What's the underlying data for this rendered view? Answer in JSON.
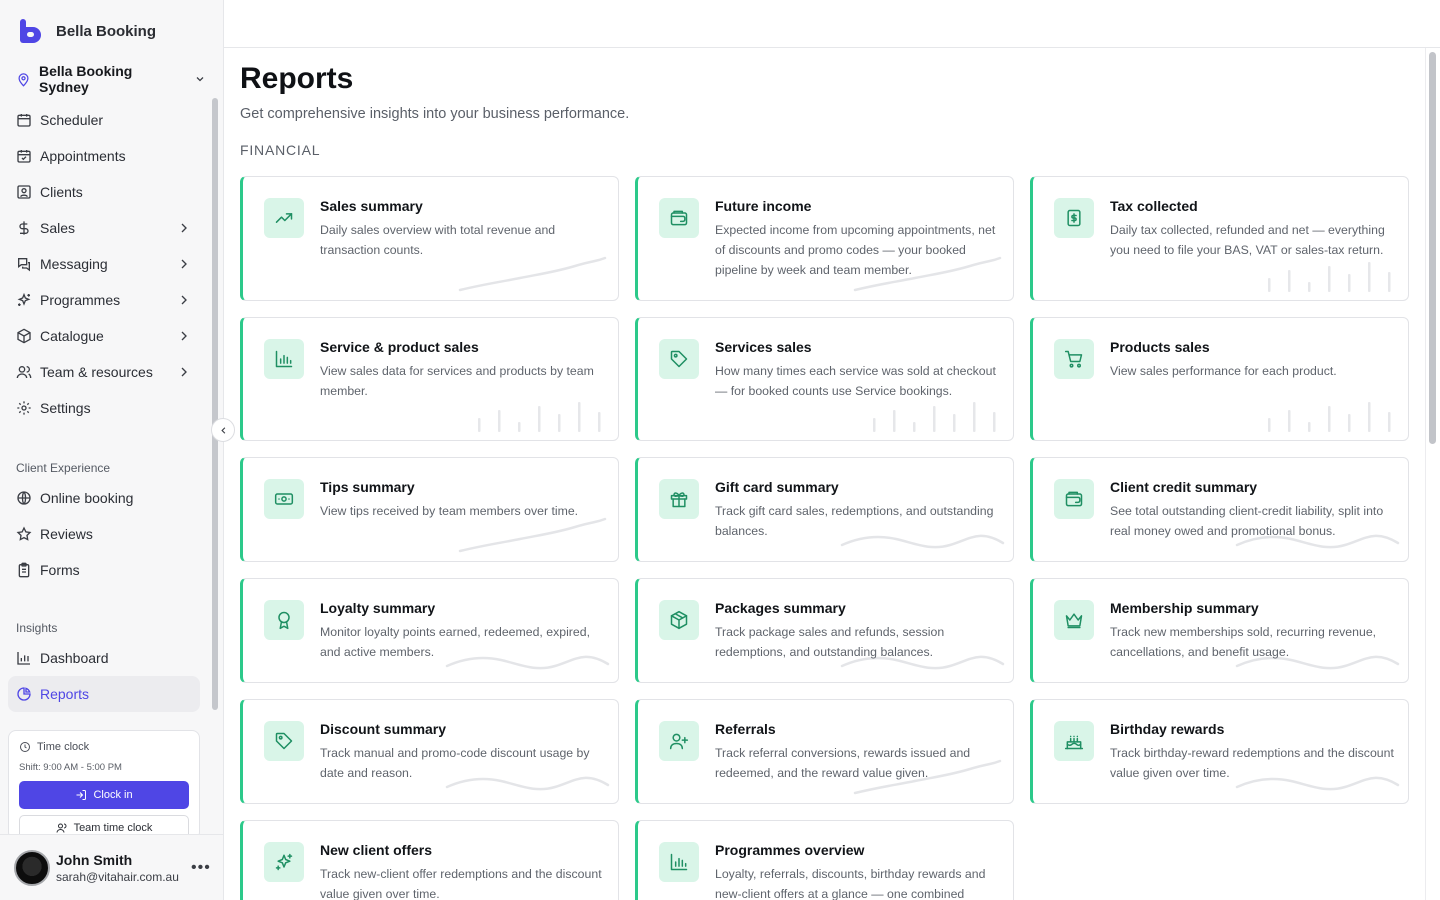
{
  "brand": {
    "name": "Bella Booking"
  },
  "location": {
    "name": "Bella Booking Sydney"
  },
  "nav": {
    "main": [
      {
        "label": "Scheduler",
        "icon": "calendar-icon"
      },
      {
        "label": "Appointments",
        "icon": "calendar-check-icon"
      },
      {
        "label": "Clients",
        "icon": "contact-icon"
      },
      {
        "label": "Sales",
        "icon": "dollar-icon"
      },
      {
        "label": "Messaging",
        "icon": "chat-icon"
      },
      {
        "label": "Programmes",
        "icon": "sparkles-icon"
      },
      {
        "label": "Catalogue",
        "icon": "box-icon"
      },
      {
        "label": "Team & resources",
        "icon": "users-icon"
      },
      {
        "label": "Settings",
        "icon": "gear-icon"
      }
    ],
    "client_experience_label": "Client Experience",
    "client_experience": [
      {
        "label": "Online booking",
        "icon": "globe-icon"
      },
      {
        "label": "Reviews",
        "icon": "star-icon"
      },
      {
        "label": "Forms",
        "icon": "clipboard-icon"
      }
    ],
    "insights_label": "Insights",
    "insights": [
      {
        "label": "Dashboard",
        "icon": "bar-chart-icon"
      },
      {
        "label": "Reports",
        "icon": "pie-chart-icon",
        "active": true
      }
    ]
  },
  "timeclock": {
    "title": "Time clock",
    "shift": "Shift: 9:00 AM - 5:00 PM",
    "clock_in": "Clock in",
    "team": "Team time clock"
  },
  "user": {
    "name": "John Smith",
    "email": "sarah@vitahair.com.au",
    "more": "•••"
  },
  "page": {
    "title": "Reports",
    "subtitle": "Get comprehensive insights into your business performance.",
    "category": "FINANCIAL"
  },
  "reports": [
    {
      "title": "Sales summary",
      "desc": "Daily sales overview with total revenue and transaction counts.",
      "icon": "trending-up-icon",
      "deco": "line"
    },
    {
      "title": "Future income",
      "desc": "Expected income from upcoming appointments, net of discounts and promo codes — your booked pipeline by week and team member.",
      "icon": "wallet-icon",
      "deco": "line"
    },
    {
      "title": "Tax collected",
      "desc": "Daily tax collected, refunded and net — everything you need to file your BAS, VAT or sales-tax return.",
      "icon": "receipt-icon",
      "deco": "bars"
    },
    {
      "title": "Service & product sales",
      "desc": "View sales data for services and products by team member.",
      "icon": "bar-chart-icon",
      "deco": "bars"
    },
    {
      "title": "Services sales",
      "desc": "How many times each service was sold at checkout — for booked counts use Service bookings.",
      "icon": "tag-icon",
      "deco": "bars"
    },
    {
      "title": "Products sales",
      "desc": "View sales performance for each product.",
      "icon": "cart-icon",
      "deco": "bars"
    },
    {
      "title": "Tips summary",
      "desc": "View tips received by team members over time.",
      "icon": "banknote-icon",
      "deco": "line"
    },
    {
      "title": "Gift card summary",
      "desc": "Track gift card sales, redemptions, and outstanding balances.",
      "icon": "gift-icon",
      "deco": "wave"
    },
    {
      "title": "Client credit summary",
      "desc": "See total outstanding client-credit liability, split into real money owed and promotional bonus.",
      "icon": "wallet-icon",
      "deco": "wave"
    },
    {
      "title": "Loyalty summary",
      "desc": "Monitor loyalty points earned, redeemed, expired, and active members.",
      "icon": "award-icon",
      "deco": "wave"
    },
    {
      "title": "Packages summary",
      "desc": "Track package sales and refunds, session redemptions, and outstanding balances.",
      "icon": "package-icon",
      "deco": "wave"
    },
    {
      "title": "Membership summary",
      "desc": "Track new memberships sold, recurring revenue, cancellations, and benefit usage.",
      "icon": "crown-icon",
      "deco": "wave"
    },
    {
      "title": "Discount summary",
      "desc": "Track manual and promo-code discount usage by date and reason.",
      "icon": "tag-icon",
      "deco": "wave"
    },
    {
      "title": "Referrals",
      "desc": "Track referral conversions, rewards issued and redeemed, and the reward value given.",
      "icon": "user-plus-icon",
      "deco": "line"
    },
    {
      "title": "Birthday rewards",
      "desc": "Track birthday-reward redemptions and the discount value given over time.",
      "icon": "cake-icon",
      "deco": "wave"
    },
    {
      "title": "New client offers",
      "desc": "Track new-client offer redemptions and the discount value given over time.",
      "icon": "sparkles-icon",
      "deco": "none"
    },
    {
      "title": "Programmes overview",
      "desc": "Loyalty, referrals, discounts, birthday rewards and new-client offers at a glance — one combined",
      "icon": "bar-chart-icon",
      "deco": "none"
    }
  ]
}
